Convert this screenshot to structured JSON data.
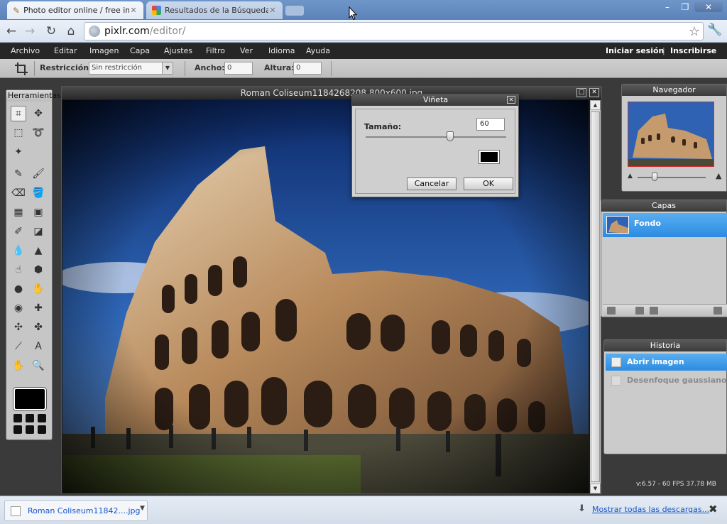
{
  "browser": {
    "tabs": [
      {
        "label": "Photo editor online / free imag",
        "active": true
      },
      {
        "label": "Resultados de la Búsqueda de",
        "active": false
      }
    ],
    "address": {
      "host": "pixlr.com",
      "path": "/editor/"
    },
    "window_controls": {
      "minimize": "–",
      "restore": "❐",
      "close": "✕"
    }
  },
  "menu": {
    "items": [
      "Archivo",
      "Editar",
      "Imagen",
      "Capa",
      "Ajustes",
      "Filtro",
      "Ver",
      "Idioma",
      "Ayuda"
    ],
    "login": "Iniciar sesión",
    "divider": "|",
    "signup": "Inscribirse"
  },
  "options": {
    "restriction_label": "Restricción:",
    "restriction_value": "Sin restricción",
    "width_label": "Ancho:",
    "width_value": "0",
    "height_label": "Altura:",
    "height_value": "0"
  },
  "tools": {
    "title": "Herramientas",
    "icons": [
      "crop-icon",
      "move-icon",
      "marquee-icon",
      "lasso-icon",
      "wand-icon",
      "blank",
      "pencil-icon",
      "brush-icon",
      "eraser-icon",
      "bucket-icon",
      "gradient-icon",
      "stamp-icon",
      "colorreplace-icon",
      "drawing-icon",
      "blur-icon",
      "sharpen-icon",
      "smudge-icon",
      "sponge-icon",
      "dodge-icon",
      "burn-icon",
      "redeye-icon",
      "spot-heal-icon",
      "bloat-icon",
      "pinch-icon",
      "eyedropper-icon",
      "text-icon",
      "hand-icon",
      "zoom-icon"
    ]
  },
  "image_window": {
    "title": "Roman Coliseum1184268208 800x600.jpg"
  },
  "dialog": {
    "title": "Viñeta",
    "size_label": "Tamaño:",
    "size_value": "60",
    "size_fraction": 0.6,
    "color": "#000000",
    "cancel": "Cancelar",
    "ok": "OK"
  },
  "navigator": {
    "title": "Navegador",
    "zoom_fraction": 0.25
  },
  "layers": {
    "title": "Capas",
    "items": [
      {
        "name": "Fondo"
      }
    ]
  },
  "history": {
    "title": "Historia",
    "items": [
      {
        "name": "Abrir imagen",
        "selected": true
      },
      {
        "name": "Desenfoque gaussiano",
        "selected": false
      }
    ]
  },
  "status": {
    "fps": "v:6.57 - 60 FPS 37.78 MB"
  },
  "downloads": {
    "file": "Roman Coliseum11842....jpg",
    "show_all": "Mostrar todas las descargas..."
  },
  "colors": {
    "accent": "#2c8ce2",
    "menu_bg": "#262626",
    "panel_bg": "#cbcbcb"
  }
}
